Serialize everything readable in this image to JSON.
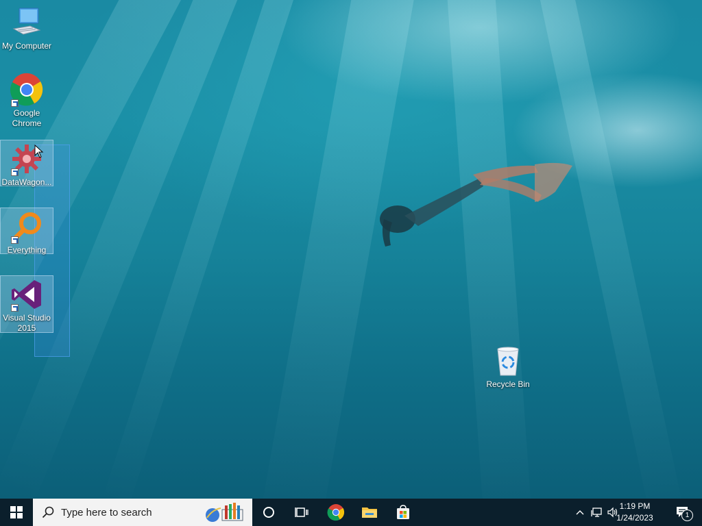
{
  "desktop": {
    "icons": [
      {
        "label": "My Computer",
        "icon": "computer-icon"
      },
      {
        "label": "Google Chrome",
        "icon": "chrome-icon"
      },
      {
        "label": "DataWagon...",
        "icon": "datawagon-icon"
      },
      {
        "label": "Everything",
        "icon": "everything-search-icon"
      },
      {
        "label": "Visual Studio 2015",
        "icon": "visual-studio-icon"
      },
      {
        "label": "Recycle Bin",
        "icon": "recycle-bin-icon"
      }
    ]
  },
  "taskbar": {
    "start_icon": "windows-start-icon",
    "search_placeholder": "Type here to search",
    "pinned": [
      {
        "icon": "cortana-icon"
      },
      {
        "icon": "task-view-icon"
      },
      {
        "icon": "chrome-icon"
      },
      {
        "icon": "file-explorer-icon"
      },
      {
        "icon": "microsoft-store-icon"
      }
    ],
    "clock": {
      "time": "1:19 PM",
      "date": "1/24/2023"
    },
    "notification_count": "1"
  },
  "colors": {
    "taskbar": "#0b1f2c",
    "water_top": "#1a8aa3",
    "water_bottom": "#0c5f78",
    "selection": "#3c8ce6"
  }
}
